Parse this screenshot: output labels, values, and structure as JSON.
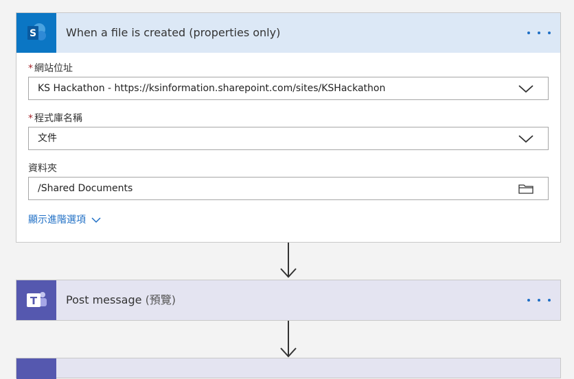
{
  "trigger": {
    "title": "When a file is created (properties only)",
    "logo_letter": "S",
    "accent": "#0b76c4",
    "header_bg": "#dce8f6",
    "icon": "sharepoint-icon",
    "fields": [
      {
        "label": "網站位址",
        "required": true,
        "value": "KS Hackathon - https://ksinformation.sharepoint.com/sites/KSHackathon",
        "icon": "chevron-down-icon"
      },
      {
        "label": "程式庫名稱",
        "required": true,
        "value": "文件",
        "icon": "chevron-down-icon"
      },
      {
        "label": "資料夾",
        "required": false,
        "value": "/Shared Documents",
        "icon": "folder-icon"
      }
    ],
    "advanced_label": "顯示進階選項"
  },
  "action": {
    "title": "Post message",
    "title_suffix": "(預覽)",
    "logo_letter": "T",
    "accent": "#5558af",
    "header_bg": "#e4e4f1",
    "icon": "teams-icon"
  },
  "required_marker": "*"
}
